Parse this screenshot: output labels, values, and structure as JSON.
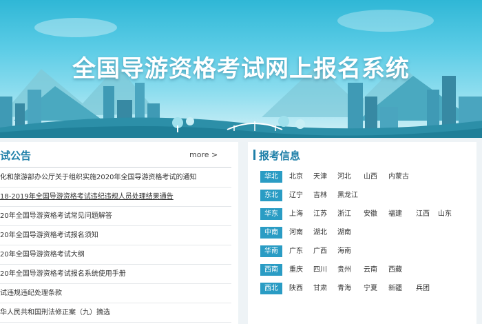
{
  "banner": {
    "title": "全国导游资格考试网上报名系统"
  },
  "announcements": {
    "title": "试公告",
    "more_label": "more >",
    "items": [
      "化和旅游部办公厅关于组织实施2020年全国导游资格考试的通知",
      "18-2019年全国导游资格考试违纪违规人员处理结果通告",
      "20年全国导游资格考试常见问题解答",
      "20年全国导游资格考试报名须知",
      "20年全国导游资格考试大纲",
      "20年全国导游资格考试报名系统使用手册",
      "试违规违纪处理条款",
      "华人民共和国刑法修正案（九）摘选"
    ]
  },
  "registration": {
    "title": "报考信息",
    "regions": [
      {
        "name": "华北",
        "provinces": [
          "北京",
          "天津",
          "河北",
          "山西",
          "内蒙古"
        ]
      },
      {
        "name": "东北",
        "provinces": [
          "辽宁",
          "吉林",
          "黑龙江"
        ]
      },
      {
        "name": "华东",
        "provinces": [
          "上海",
          "江苏",
          "浙江",
          "安徽",
          "福建",
          "江西",
          "山东"
        ]
      },
      {
        "name": "中南",
        "provinces": [
          "河南",
          "湖北",
          "湖南"
        ]
      },
      {
        "name": "华南",
        "provinces": [
          "广东",
          "广西",
          "海南"
        ]
      },
      {
        "name": "西南",
        "provinces": [
          "重庆",
          "四川",
          "贵州",
          "云南",
          "西藏"
        ]
      },
      {
        "name": "西北",
        "provinces": [
          "陕西",
          "甘肃",
          "青海",
          "宁夏",
          "新疆",
          "兵团"
        ]
      }
    ]
  },
  "colors": {
    "accent": "#1e7fa8",
    "region_tag": "#2a9cc4",
    "banner_top": "#2fb7d6"
  }
}
